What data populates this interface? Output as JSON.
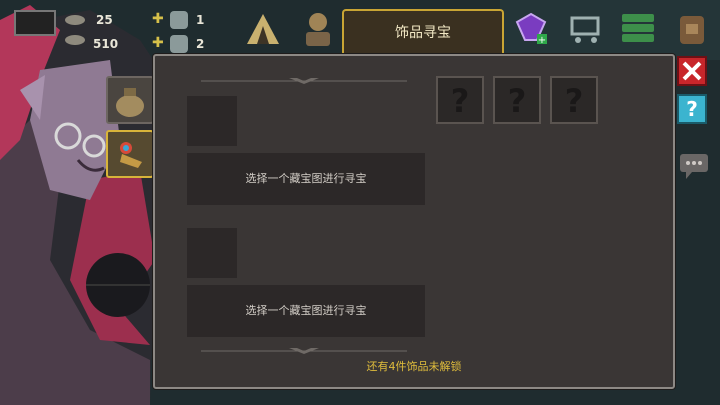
{
  "hud": {
    "resource_top": "25",
    "resource_bottom": "510",
    "count_top": "1",
    "count_bottom": "2"
  },
  "tab": {
    "label": "饰品寻宝"
  },
  "panel": {
    "slots": [
      {
        "hint": "选择一个藏宝图进行寻宝"
      },
      {
        "hint": "选择一个藏宝图进行寻宝"
      }
    ],
    "unknown_slots": [
      "?",
      "?",
      "?"
    ],
    "locked_text": "还有4件饰品未解锁"
  },
  "colors": {
    "tab_border": "#c9a534",
    "panel_bg": "#3a3635",
    "highlight_text": "#e0bd3c",
    "close_red": "#c8262b",
    "help_cyan": "#3bb4cf"
  },
  "icons": {
    "side_1": "sack-icon",
    "side_2": "bird-trinket-icon",
    "top_right": [
      "gem-add-icon",
      "shop-cart-icon",
      "list-menu-icon",
      "backpack-icon"
    ],
    "right_column": [
      "close-icon",
      "help-icon",
      "chat-icon"
    ]
  }
}
